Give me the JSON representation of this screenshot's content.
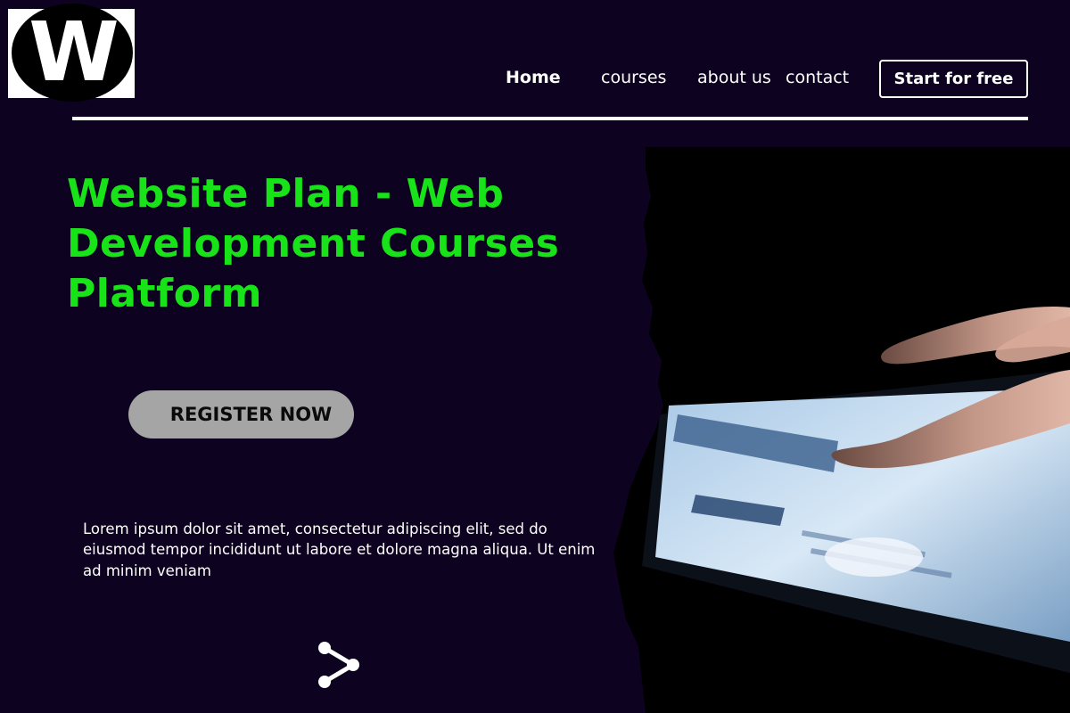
{
  "logo": {
    "letter": "W"
  },
  "nav": {
    "items": [
      {
        "label": "Home",
        "active": true
      },
      {
        "label": "courses"
      },
      {
        "label": "about us"
      },
      {
        "label": "contact"
      }
    ],
    "cta_label": "Start for free"
  },
  "hero": {
    "title": "Website Plan - Web Development Courses Platform",
    "register_label": "REGISTER NOW",
    "description": "Lorem ipsum dolor sit amet, consectetur adipiscing elit, sed do eiusmod tempor incididunt ut labore et dolore magna aliqua. Ut enim ad minim veniam",
    "share_icon": "share-icon",
    "photo": "hand-touching-tablet-image"
  },
  "colors": {
    "background": "#0d0320",
    "title_accent": "#18e318",
    "register_button": "#a5a5a5",
    "text": "#ffffff"
  }
}
